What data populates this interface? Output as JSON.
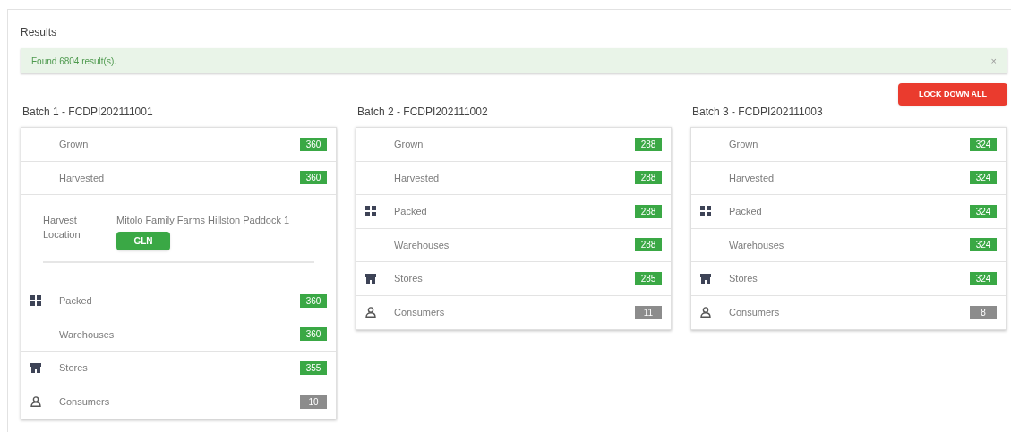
{
  "title": "Results",
  "alert": {
    "message": "Found 6804 result(s).",
    "close": "×"
  },
  "lock_button": "LOCK DOWN ALL",
  "batches": [
    {
      "title": "Batch 1 - FCDPI202111001",
      "rows": [
        {
          "kind": "plain",
          "label": "Grown",
          "count": "360",
          "color": "#3aa845"
        },
        {
          "kind": "plain",
          "label": "Harvested",
          "count": "360",
          "color": "#3aa845"
        },
        {
          "kind": "location",
          "label": "Harvest Location",
          "value": "Mitolo Family Farms Hillston Paddock 1",
          "button": "GLN"
        },
        {
          "kind": "packed",
          "label": "Packed",
          "count": "360",
          "color": "#3aa845"
        },
        {
          "kind": "plain",
          "label": "Warehouses",
          "count": "360",
          "color": "#3aa845"
        },
        {
          "kind": "store",
          "label": "Stores",
          "count": "355",
          "color": "#3aa845"
        },
        {
          "kind": "person",
          "label": "Consumers",
          "count": "10",
          "color": "#8c8c8c"
        }
      ]
    },
    {
      "title": "Batch 2 - FCDPI202111002",
      "rows": [
        {
          "kind": "plain",
          "label": "Grown",
          "count": "288",
          "color": "#3aa845"
        },
        {
          "kind": "plain",
          "label": "Harvested",
          "count": "288",
          "color": "#3aa845"
        },
        {
          "kind": "packed",
          "label": "Packed",
          "count": "288",
          "color": "#3aa845"
        },
        {
          "kind": "plain",
          "label": "Warehouses",
          "count": "288",
          "color": "#3aa845"
        },
        {
          "kind": "store",
          "label": "Stores",
          "count": "285",
          "color": "#3aa845"
        },
        {
          "kind": "person",
          "label": "Consumers",
          "count": "11",
          "color": "#8c8c8c"
        }
      ]
    },
    {
      "title": "Batch 3 - FCDPI202111003",
      "rows": [
        {
          "kind": "plain",
          "label": "Grown",
          "count": "324",
          "color": "#3aa845"
        },
        {
          "kind": "plain",
          "label": "Harvested",
          "count": "324",
          "color": "#3aa845"
        },
        {
          "kind": "packed",
          "label": "Packed",
          "count": "324",
          "color": "#3aa845"
        },
        {
          "kind": "plain",
          "label": "Warehouses",
          "count": "324",
          "color": "#3aa845"
        },
        {
          "kind": "store",
          "label": "Stores",
          "count": "324",
          "color": "#3aa845"
        },
        {
          "kind": "person",
          "label": "Consumers",
          "count": "8",
          "color": "#8c8c8c"
        }
      ]
    }
  ]
}
